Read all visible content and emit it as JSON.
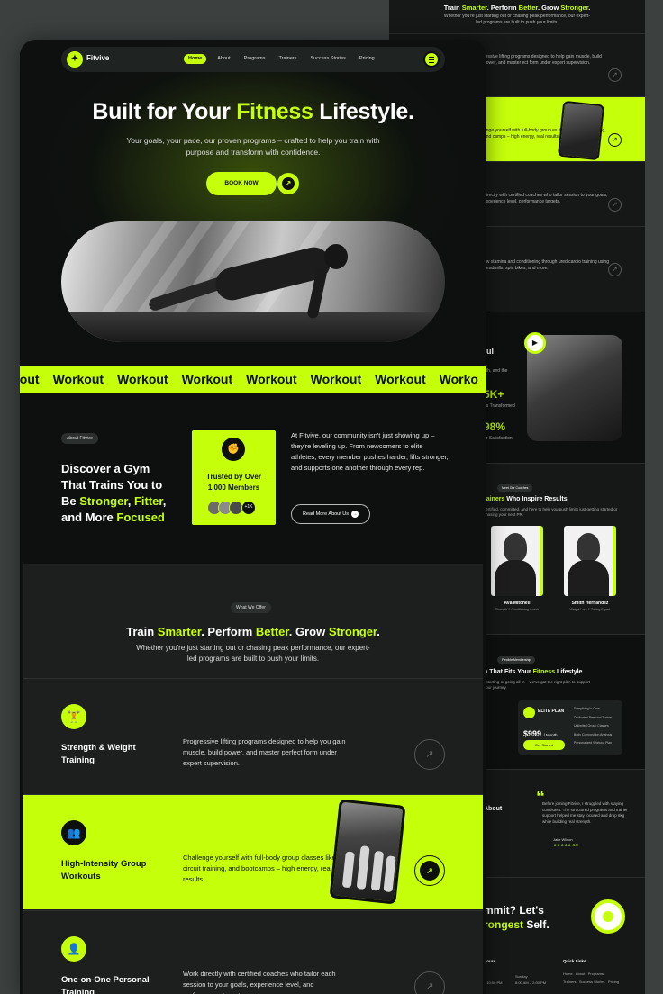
{
  "colors": {
    "accent": "#c6ff0a",
    "bg_dark": "#0d100f",
    "bg_panel": "#1c1f1e",
    "page_bg": "#3c4140"
  },
  "nav": {
    "brand": "Fitvive",
    "logo_icon": "dumbbell-icon",
    "links": [
      "Home",
      "About",
      "Programs",
      "Trainers",
      "Success Stories",
      "Pricing"
    ],
    "active": "Home",
    "menu_icon": "hamburger-menu-icon"
  },
  "hero": {
    "title_pre": "Built for Your ",
    "title_accent": "Fitness",
    "title_post": " Lifestyle.",
    "subtitle": "Your goals, your pace, our proven programs – crafted to help you train with purpose and transform with confidence.",
    "cta": "BOOK NOW",
    "image_alt": "athlete-pushup-photo"
  },
  "ticker": {
    "word": "Workout",
    "items": [
      "kout",
      "Workout",
      "Workout",
      "Workout",
      "Workout",
      "Workout",
      "Workout",
      "Worko"
    ]
  },
  "about": {
    "tag": "About Fitvive",
    "h_l1": "Discover a Gym",
    "h_l2": "That Trains You to",
    "h_l3a": "Be ",
    "h_l3b": "Stronger",
    "h_l3c": ", ",
    "h_l3d": "Fitter",
    "h_l3e": ",",
    "h_l4a": "and More ",
    "h_l4b": "Focused",
    "trust_text": "Trusted by Over 1,000 Members",
    "trust_count": "+1K",
    "body": "At Fitvive, our community isn't just showing up – they're leveling up. From newcomers to elite athletes, every member pushes harder, lifts stronger, and supports one another through every rep.",
    "cta": "Read More About Us"
  },
  "offer": {
    "tag": "What We Offer",
    "h_a": "Train ",
    "h_b": "Smarter",
    "h_c": ". Perform ",
    "h_d": "Better",
    "h_e": ". Grow ",
    "h_f": "Stronger",
    "h_g": ".",
    "subtitle": "Whether you're just starting out or chasing peak performance, our expert-led programs are built to push your limits.",
    "services": [
      {
        "title": "Strength & Weight Training",
        "text": "Progressive lifting programs designed to help you gain muscle, build power, and master perfect form under expert supervision.",
        "icon": "weightlifting-icon"
      },
      {
        "title": "High-Intensity Group Workouts",
        "text": "Challenge yourself with full-body group classes like HIIT, circuit training, and bootcamps – high energy, real results.",
        "icon": "group-workout-icon"
      },
      {
        "title": "One-on-One Personal Training",
        "text": "Work directly with certified coaches who tailor each session to your goals, experience level, and performance targets.",
        "icon": "personal-trainer-icon"
      }
    ]
  },
  "bg_mock": {
    "top_a": "Train ",
    "top_b": "Smarter",
    "top_c": ". Perform ",
    "top_d": "Better",
    "top_e": ". Grow ",
    "top_f": "Stronger",
    "top_g": ".",
    "top_sub": "Whether you're just starting out or chasing peak performance, our expert-led programs are built to push your limits.",
    "rows": [
      "ressive lifting programs designed to help gain muscle, build power, and master ect form under expert supervision.",
      "enge yourself with full-body group es like HIIT, circuit training, and camps – high energy, real results.",
      "directly with certified coaches who tailor session to your goals, experience level, performance targets.",
      "ow stamina and conditioning through ured cardio training using treadmills, spin bikes, and more."
    ],
    "stats_title": "ful",
    "stats_s1": "gth, and the",
    "stats_big1": "5K+",
    "stats_s2": "es Transformed",
    "stats_big2": "98%",
    "stats_s3": "er Satisfaction",
    "trainers_tag": "Meet Our Coaches",
    "trainers_h_a": "rainers",
    "trainers_h_b": " Who Inspire Results",
    "trainers_sub": "certified, committed, and here to help you push limits just getting started or chasing your next PR.",
    "trainers": [
      {
        "name": "Ava Mitchell",
        "role": "Strength & Conditioning Coach"
      },
      {
        "name": "Smith Hernandez",
        "role": "Weight Loss & Toning Expert"
      }
    ],
    "plans_tag": "Flexible Membership",
    "plans_h_a": "n That Fits Your ",
    "plans_h_b": "Fitness",
    "plans_h_c": " Lifestyle",
    "plans_sub": "t starting or going all-in – we've got the right plan to support your journey.",
    "plan_name": "ELITE PLAN",
    "plan_price": "$999",
    "plan_period": "/ Month",
    "plan_cta": "Get Started",
    "plan_features": [
      "Everything in Core",
      "Dedicated Personal Trainer",
      "Unlimited Group Classes",
      "Body Composition Analysis",
      "Personalized Workout Plan"
    ],
    "test_title": "About",
    "test_quote": "Before joining Fitvive, I struggled with staying consistent. The structured programs and trainer support helped me stay focused and drop 6kg while building real strength.",
    "test_author": "Jake Wilson",
    "test_stars": "★★★★★ 4.8",
    "cta_l1": "mmit? Let's",
    "cta_l2": "rongest",
    "cta_l3": " Self.",
    "foot_hours": "Hours",
    "foot_day": "Sunday",
    "foot_time1": "– 10:00 PM",
    "foot_time2": "8:00 AM – 2:00 PM",
    "foot_links_h": "Quick Links",
    "foot_links": [
      "Home",
      "About",
      "Programs",
      "Trainers",
      "Success Stories",
      "Pricing"
    ]
  }
}
